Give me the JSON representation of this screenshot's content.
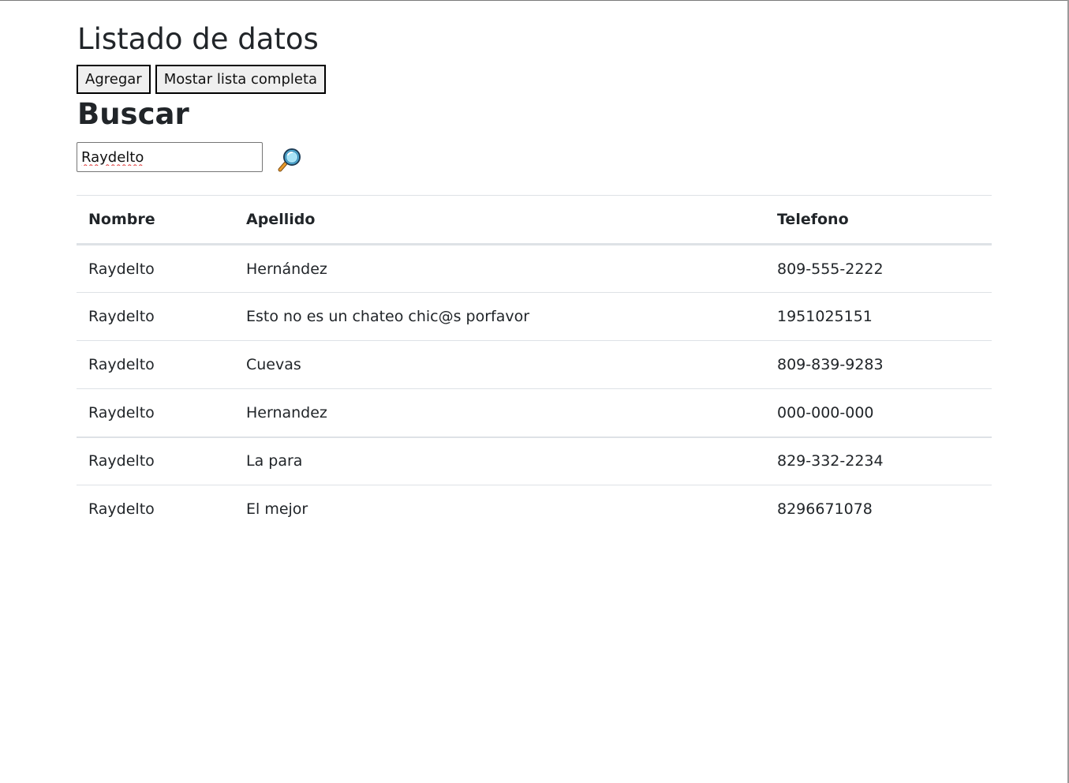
{
  "page": {
    "title": "Listado de datos",
    "buttons": {
      "agregar": "Agregar",
      "mostrar": "Mostar lista completa"
    },
    "search": {
      "heading": "Buscar",
      "value": "Raydelto",
      "icon": "magnifier-icon"
    }
  },
  "table": {
    "headers": {
      "nombre": "Nombre",
      "apellido": "Apellido",
      "telefono": "Telefono"
    },
    "rows": [
      {
        "nombre": "Raydelto",
        "apellido": "Hernández",
        "telefono": "809-555-2222"
      },
      {
        "nombre": "Raydelto",
        "apellido": "Esto no es un chateo chic@s porfavor",
        "telefono": "1951025151"
      },
      {
        "nombre": "Raydelto",
        "apellido": "Cuevas",
        "telefono": "809-839-9283"
      },
      {
        "nombre": "Raydelto",
        "apellido": "Hernandez",
        "telefono": "000-000-000"
      },
      {
        "nombre": "Raydelto",
        "apellido": "La para",
        "telefono": "829-332-2234"
      },
      {
        "nombre": "Raydelto",
        "apellido": "El mejor",
        "telefono": "8296671078"
      }
    ]
  },
  "colors": {
    "text": "#212529",
    "border": "#dee2e6",
    "button_bg": "#efefef",
    "spellcheck_underline": "#d33"
  }
}
